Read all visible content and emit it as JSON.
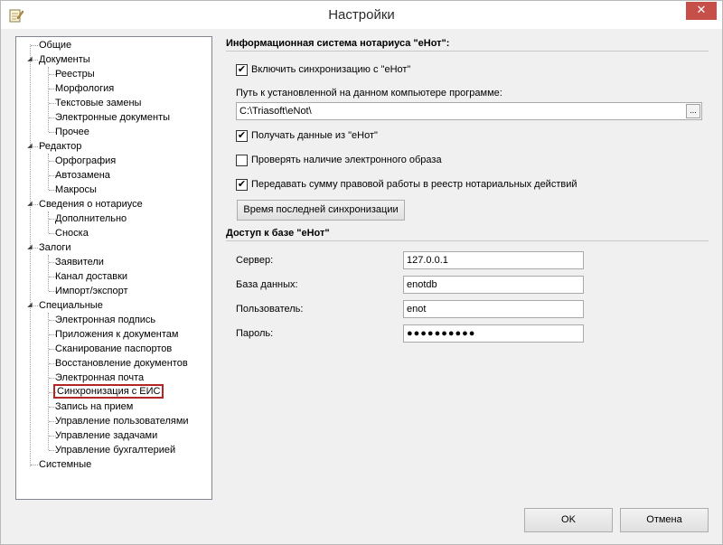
{
  "window": {
    "title": "Настройки",
    "close_symbol": "✕",
    "icon": "notepad-pencil-icon"
  },
  "tree": {
    "items": [
      {
        "label": "Общие",
        "level": 0
      },
      {
        "label": "Документы",
        "level": 0,
        "expanded": true
      },
      {
        "label": "Реестры",
        "level": 1
      },
      {
        "label": "Морфология",
        "level": 1
      },
      {
        "label": "Текстовые замены",
        "level": 1
      },
      {
        "label": "Электронные документы",
        "level": 1
      },
      {
        "label": "Прочее",
        "level": 1
      },
      {
        "label": "Редактор",
        "level": 0,
        "expanded": true
      },
      {
        "label": "Орфография",
        "level": 1
      },
      {
        "label": "Автозамена",
        "level": 1
      },
      {
        "label": "Макросы",
        "level": 1
      },
      {
        "label": "Сведения о нотариусе",
        "level": 0,
        "expanded": true
      },
      {
        "label": "Дополнительно",
        "level": 1
      },
      {
        "label": "Сноска",
        "level": 1
      },
      {
        "label": "Залоги",
        "level": 0,
        "expanded": true
      },
      {
        "label": "Заявители",
        "level": 1
      },
      {
        "label": "Канал доставки",
        "level": 1
      },
      {
        "label": "Импорт/экспорт",
        "level": 1
      },
      {
        "label": "Специальные",
        "level": 0,
        "expanded": true
      },
      {
        "label": "Электронная подпись",
        "level": 1
      },
      {
        "label": "Приложения к документам",
        "level": 1
      },
      {
        "label": "Сканирование паспортов",
        "level": 1
      },
      {
        "label": "Восстановление документов",
        "level": 1
      },
      {
        "label": "Электронная почта",
        "level": 1
      },
      {
        "label": "Синхронизация с ЕИС",
        "level": 1,
        "selected": true
      },
      {
        "label": "Запись на прием",
        "level": 1
      },
      {
        "label": "Управление пользователями",
        "level": 1
      },
      {
        "label": "Управление задачами",
        "level": 1
      },
      {
        "label": "Управление бухгалтерией",
        "level": 1
      },
      {
        "label": "Системные",
        "level": 0
      }
    ]
  },
  "eis": {
    "title": "Информационная система нотариуса \"еНот\":",
    "enable_sync": {
      "label": "Включить синхронизацию с \"еНот\"",
      "checked": true
    },
    "path_label": "Путь к установленной на данном компьютере программе:",
    "path_value": "C:\\Triasoft\\eNot\\",
    "browse_label": "...",
    "get_data": {
      "label": "Получать данные из \"еНот\"",
      "checked": true
    },
    "check_image": {
      "label": "Проверять наличие электронного образа",
      "checked": false
    },
    "send_sum": {
      "label": "Передавать сумму правовой работы в реестр нотариальных действий",
      "checked": true
    },
    "last_sync_button": "Время последней синхронизации"
  },
  "db": {
    "title": "Доступ к базе \"еНот\"",
    "fields": [
      {
        "label": "Сервер:",
        "value": "127.0.0.1"
      },
      {
        "label": "База данных:",
        "value": "enotdb"
      },
      {
        "label": "Пользователь:",
        "value": "enot"
      },
      {
        "label": "Пароль:",
        "value": "●●●●●●●●●●"
      }
    ]
  },
  "footer": {
    "ok_label": "OK",
    "cancel_label": "Отмена"
  },
  "check_mark": "✔",
  "colors": {
    "close_button": "#c74f4a",
    "selection_border": "#b42525",
    "tree_border": "#828790"
  }
}
